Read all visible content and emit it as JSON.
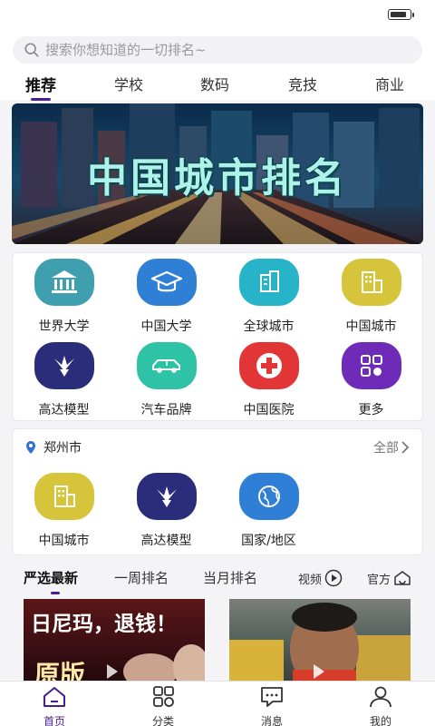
{
  "status": {
    "battery_level": 0.85
  },
  "search": {
    "placeholder": "搜索你想知道的一切排名~"
  },
  "tabs": [
    {
      "label": "推荐",
      "active": true
    },
    {
      "label": "学校"
    },
    {
      "label": "数码"
    },
    {
      "label": "竞技"
    },
    {
      "label": "商业"
    }
  ],
  "banner": {
    "title": "中国城市排名"
  },
  "categories": [
    {
      "label": "世界大学",
      "icon": "bank-icon",
      "color": "#3f9fae"
    },
    {
      "label": "中国大学",
      "icon": "graduation-cap-icon",
      "color": "#2f7fd6"
    },
    {
      "label": "全球城市",
      "icon": "building-icon",
      "color": "#27b3c8"
    },
    {
      "label": "中国城市",
      "icon": "city-icon",
      "color": "#d6c43a"
    },
    {
      "label": "高达模型",
      "icon": "gundam-icon",
      "color": "#2a2e7a"
    },
    {
      "label": "汽车品牌",
      "icon": "car-icon",
      "color": "#2ec3a7"
    },
    {
      "label": "中国医院",
      "icon": "hospital-cross-icon",
      "color": "#e23535"
    },
    {
      "label": "更多",
      "icon": "more-grid-icon",
      "color": "#6d2bb8"
    }
  ],
  "city_section": {
    "city": "郑州市",
    "all_label": "全部",
    "items": [
      {
        "label": "中国城市",
        "icon": "city-icon",
        "color": "#d6c43a"
      },
      {
        "label": "高达模型",
        "icon": "gundam-icon",
        "color": "#2a2e7a"
      },
      {
        "label": "国家/地区",
        "icon": "globe-icon",
        "color": "#2f7fd6"
      }
    ]
  },
  "subtabs": [
    {
      "label": "严选最新",
      "active": true
    },
    {
      "label": "一周排名"
    },
    {
      "label": "当月排名"
    },
    {
      "label": "视频"
    },
    {
      "label": "官方"
    }
  ],
  "thumbnails": [
    {
      "caption_line1": "日尼玛，退钱！",
      "caption_line2": "原版"
    },
    {
      "caption_line1": ""
    }
  ],
  "bottom_nav": [
    {
      "label": "首页",
      "icon": "home-icon",
      "active": true
    },
    {
      "label": "分类",
      "icon": "category-icon"
    },
    {
      "label": "消息",
      "icon": "message-icon"
    },
    {
      "label": "我的",
      "icon": "user-icon"
    }
  ],
  "colors": {
    "accent": "#4a1d91",
    "nav_inactive": "#333333"
  }
}
